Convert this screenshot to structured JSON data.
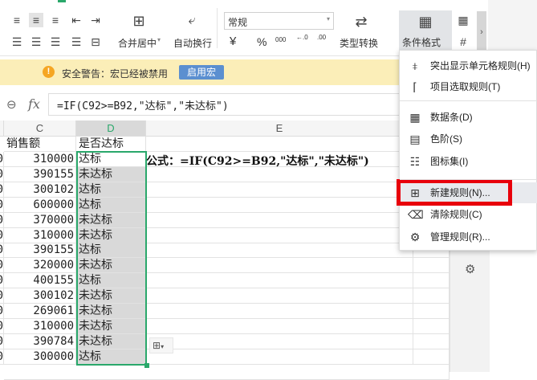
{
  "ribbon": {
    "merge_center": "合并居中",
    "auto_wrap": "自动换行",
    "number_format": "常规",
    "type_convert": "类型转换",
    "conditional_format": "条件格式",
    "currency_symbol": "¥",
    "percent_symbol": "%",
    "thousands_symbol": "000",
    "increase_decimal": "←.0",
    "decrease_decimal": ".00"
  },
  "warning": {
    "text": "安全警告：宏已经被禁用",
    "button": "启用宏"
  },
  "formula_bar": {
    "fx": "fx",
    "formula": "=IF(C92>=B92,\"达标\",\"未达标\")"
  },
  "grid": {
    "columns": [
      "C",
      "D",
      "E"
    ],
    "header_row": {
      "c": "销售额",
      "d": "是否达标"
    },
    "note": "公式：=IF(C92>=B92,\"达标\",\"未达标\")",
    "rows": [
      {
        "c": "310000",
        "d": "达标"
      },
      {
        "c": "390155",
        "d": "未达标"
      },
      {
        "c": "300102",
        "d": "达标"
      },
      {
        "c": "600000",
        "d": "达标"
      },
      {
        "c": "370000",
        "d": "未达标"
      },
      {
        "c": "310000",
        "d": "未达标"
      },
      {
        "c": "390155",
        "d": "达标"
      },
      {
        "c": "320000",
        "d": "未达标"
      },
      {
        "c": "400155",
        "d": "达标"
      },
      {
        "c": "300102",
        "d": "未达标"
      },
      {
        "c": "269061",
        "d": "未达标"
      },
      {
        "c": "310000",
        "d": "未达标"
      },
      {
        "c": "390784",
        "d": "未达标"
      },
      {
        "c": "300000",
        "d": "达标"
      }
    ]
  },
  "menu": {
    "items": [
      {
        "label": "突出显示单元格规则(H)",
        "icon": "highlight-rules-icon"
      },
      {
        "label": "项目选取规则(T)",
        "icon": "top-bottom-icon"
      },
      {
        "label": "数据条(D)",
        "icon": "data-bar-icon"
      },
      {
        "label": "色阶(S)",
        "icon": "color-scale-icon"
      },
      {
        "label": "图标集(I)",
        "icon": "icon-set-icon"
      },
      {
        "label": "新建规则(N)...",
        "icon": "new-rule-icon",
        "highlighted": true
      },
      {
        "label": "清除规则(C)",
        "icon": "clear-rule-icon"
      },
      {
        "label": "管理规则(R)...",
        "icon": "manage-rule-icon"
      }
    ],
    "highlight_color": "#e8000b"
  }
}
